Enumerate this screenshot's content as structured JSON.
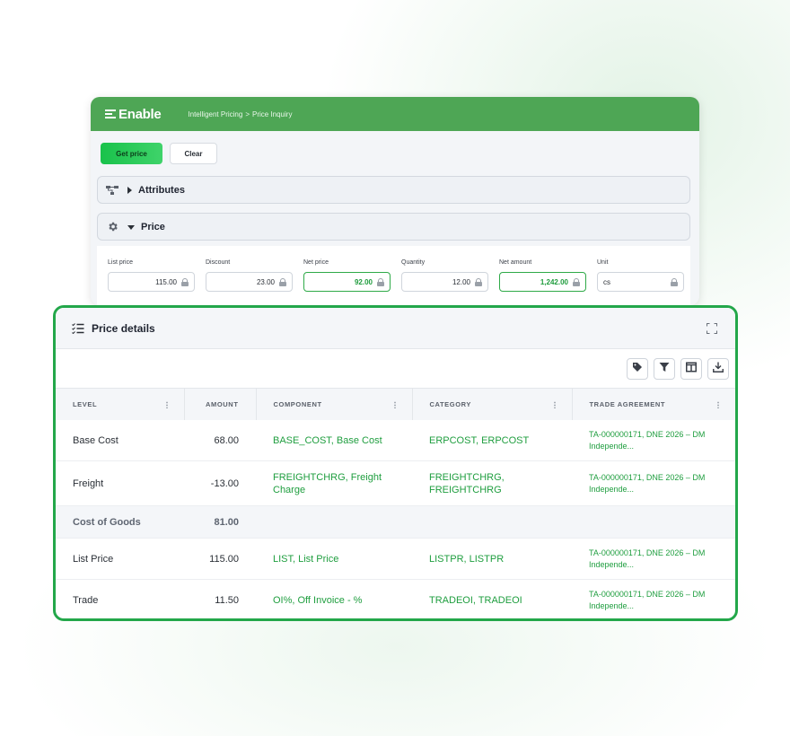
{
  "app": {
    "brand": "Enable",
    "breadcrumb": [
      "Intelligent Pricing",
      "Price Inquiry"
    ],
    "breadcrumb_sep": ">"
  },
  "toolbar": {
    "get_price": "Get price",
    "clear": "Clear"
  },
  "panels": {
    "attributes": {
      "title": "Attributes",
      "icon": "hierarchy-icon",
      "state": "collapsed"
    },
    "price": {
      "title": "Price",
      "icon": "gear-icon",
      "state": "expanded"
    }
  },
  "price_fields": [
    {
      "label": "List price",
      "value": "115.00",
      "highlight": false
    },
    {
      "label": "Discount",
      "value": "23.00",
      "highlight": false
    },
    {
      "label": "Net price",
      "value": "92.00",
      "highlight": true
    },
    {
      "label": "Quantity",
      "value": "12.00",
      "highlight": false
    },
    {
      "label": "Net amount",
      "value": "1,242.00",
      "highlight": true
    },
    {
      "label": "Unit",
      "value": "cs",
      "highlight": false
    }
  ],
  "details": {
    "title": "Price details",
    "columns": [
      "LEVEL",
      "AMOUNT",
      "COMPONENT",
      "CATEGORY",
      "TRADE AGREEMENT"
    ],
    "rows": [
      {
        "level": "Base Cost",
        "amount": "68.00",
        "component": "BASE_COST, Base Cost",
        "category": "ERPCOST, ERPCOST",
        "trade": "TA-000000171, DNE 2026 – DM Independe..."
      },
      {
        "level": "Freight",
        "amount": "-13.00",
        "component": "FREIGHTCHRG, Freight Charge",
        "category": "FREIGHTCHRG, FREIGHTCHRG",
        "trade": "TA-000000171, DNE 2026 – DM Independe..."
      },
      {
        "level": "Cost of Goods",
        "amount": "81.00",
        "component": "",
        "category": "",
        "trade": ""
      },
      {
        "level": "List Price",
        "amount": "115.00",
        "component": "LIST, List Price",
        "category": "LISTPR, LISTPR",
        "trade": "TA-000000171, DNE 2026 – DM Independe..."
      },
      {
        "level": "Trade",
        "amount": "11.50",
        "component": "OI%, Off Invoice - %",
        "category": "TRADEOI, TRADEOI",
        "trade": "TA-000000171, DNE 2026 – DM Independe..."
      }
    ]
  },
  "tools": [
    "tag-icon",
    "filter-icon",
    "columns-icon",
    "download-icon"
  ],
  "colors": {
    "brand_green": "#4ea655",
    "accent_green": "#23a74a",
    "link_green": "#1f9e3f"
  }
}
